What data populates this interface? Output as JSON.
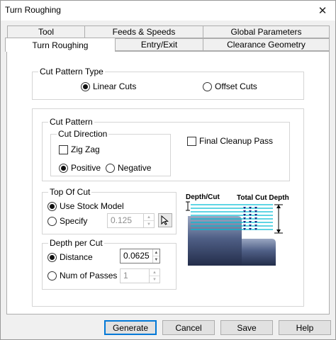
{
  "window": {
    "title": "Turn Roughing",
    "close_glyph": "✕"
  },
  "tabs": {
    "row1": [
      {
        "label": "Tool"
      },
      {
        "label": "Feeds & Speeds"
      },
      {
        "label": "Global Parameters"
      }
    ],
    "row2": [
      {
        "label": "Turn Roughing"
      },
      {
        "label": "Entry/Exit"
      },
      {
        "label": "Clearance Geometry"
      }
    ],
    "active": "Turn Roughing"
  },
  "cut_pattern_type": {
    "legend": "Cut Pattern Type",
    "linear": "Linear Cuts",
    "offset": "Offset Cuts",
    "selected": "Linear Cuts"
  },
  "cut_pattern": {
    "legend": "Cut Pattern",
    "direction_legend": "Cut Direction",
    "zigzag": "Zig Zag",
    "zigzag_checked": false,
    "positive": "Positive",
    "negative": "Negative",
    "direction_selected": "Positive",
    "final_cleanup": "Final Cleanup Pass",
    "final_cleanup_checked": false
  },
  "top_of_cut": {
    "legend": "Top Of Cut",
    "use_stock": "Use Stock Model",
    "specify": "Specify",
    "selected": "Use Stock Model",
    "specify_value": "0.125",
    "pick_icon": "cursor-arrow-icon"
  },
  "depth_per_cut": {
    "legend": "Depth per Cut",
    "distance": "Distance",
    "num_passes": "Num of Passes",
    "selected": "Distance",
    "distance_value": "0.0625",
    "passes_value": "1"
  },
  "diagram": {
    "depth_label": "Depth/Cut",
    "total_label": "Total Cut Depth",
    "cut_line_color": "#00bcd4",
    "arrow_color": "#1a237e",
    "cut_lines": 8
  },
  "buttons": {
    "generate": "Generate",
    "cancel": "Cancel",
    "save": "Save",
    "help": "Help"
  },
  "colors": {
    "accent": "#0078d7"
  }
}
